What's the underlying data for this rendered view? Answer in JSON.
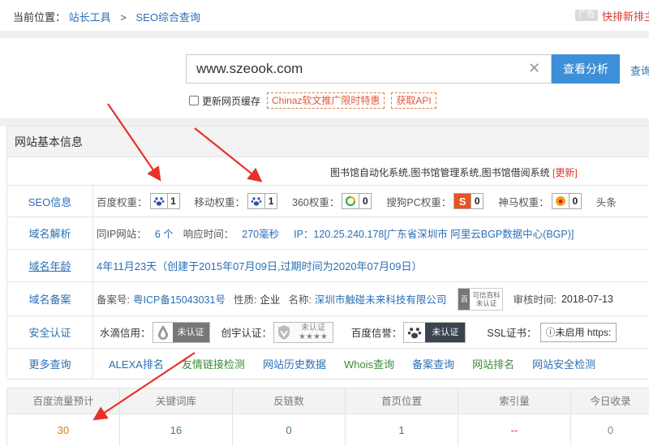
{
  "breadcrumb": {
    "prefix": "当前位置：",
    "home": "站长工具",
    "separator": ">",
    "current": "SEO综合查询"
  },
  "ad": {
    "badge": "广告",
    "text": "快排新排主"
  },
  "search": {
    "value": "www.szeook.com",
    "analyze_label": "查看分析",
    "more_label": "查询",
    "clear_icon": "close-icon"
  },
  "options": {
    "refresh_cache_label": "更新网页缓存",
    "promo_1": "Chinaz软文推广限时特惠",
    "promo_2": "获取API"
  },
  "panel": {
    "title": "网站基本信息",
    "system_line": "图书馆自动化系统,图书馆管理系统,图书馆借阅系统",
    "update_label": "[更新]",
    "seo": {
      "label": "SEO信息",
      "items": [
        {
          "label": "百度权重：",
          "value": "1",
          "icon": "baidu-paw-icon"
        },
        {
          "label": "移动权重：",
          "value": "1",
          "icon": "baidu-paw-icon"
        },
        {
          "label": "360权重：",
          "value": "0",
          "icon": "360-icon"
        },
        {
          "label": "搜狗PC权重：",
          "value": "0",
          "icon": "sogou-icon"
        },
        {
          "label": "神马权重：",
          "value": "0",
          "icon": "shenma-icon"
        }
      ],
      "trailing": "头条"
    },
    "dns": {
      "label": "域名解析",
      "same_ip_label": "同IP网站：",
      "same_ip_value": "6 个",
      "response_label": "响应时间：",
      "response_value": "270毫秒",
      "ip_text": "IP：120.25.240.178[广东省深圳市 阿里云BGP数据中心(BGP)]"
    },
    "age": {
      "label": "域名年龄",
      "value": "4年11月23天（创建于2015年07月09日,过期时间为2020年07月09日）"
    },
    "icp": {
      "label": "域名备案",
      "number_label": "备案号:",
      "number_value": "粤ICP备15043031号",
      "nature_label": "性质:",
      "nature_value": "企业",
      "name_label": "名称:",
      "name_value": "深圳市触碰未来科技有限公司",
      "baike_icon": "百",
      "baike_line1": "可信百科",
      "baike_line2": "未认证",
      "review_label": "审核时间:",
      "review_value": "2018-07-13"
    },
    "security": {
      "label": "安全认证",
      "water_label": "水滴信用：",
      "water_badge": "未认证",
      "chuangyu_label": "创宇认证：",
      "chuangyu_line1": "未认证",
      "chuangyu_line2": "★★★★",
      "baidu_label": "百度信誉：",
      "baidu_badge": "未认证",
      "ssl_label": "SSL证书：",
      "ssl_value": "ⓘ未启用 https:"
    },
    "more": {
      "label": "更多查询",
      "links": [
        "ALEXA排名",
        "友情链接检测",
        "网站历史数据",
        "Whois查询",
        "备案查询",
        "网站排名",
        "网站安全检测"
      ]
    },
    "colors": {
      "link_blue": "#2a6fb5",
      "link_green": "#3b8a3b",
      "accent_red": "#d9362b",
      "button_blue": "#3d8fd8"
    }
  },
  "stats": {
    "headers": [
      "百度流量预计",
      "关键词库",
      "反链数",
      "首页位置",
      "索引量",
      "今日收录"
    ],
    "values": [
      "30",
      "16",
      "0",
      "1",
      "--",
      "0"
    ]
  }
}
